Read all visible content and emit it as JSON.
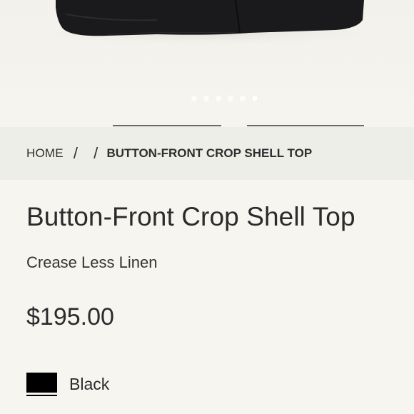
{
  "gallery": {
    "image_alt": "black button-front crop shell top",
    "dots_total": 6,
    "active_dot": 6
  },
  "breadcrumb": {
    "home": "HOME",
    "separator": "/",
    "current": "BUTTON-FRONT CROP SHELL TOP"
  },
  "product": {
    "title": "Button-Front Crop Shell Top",
    "fabric": "Crease Less Linen",
    "price": "$195.00",
    "selected_color": {
      "name": "Black",
      "hex": "#000000"
    }
  }
}
